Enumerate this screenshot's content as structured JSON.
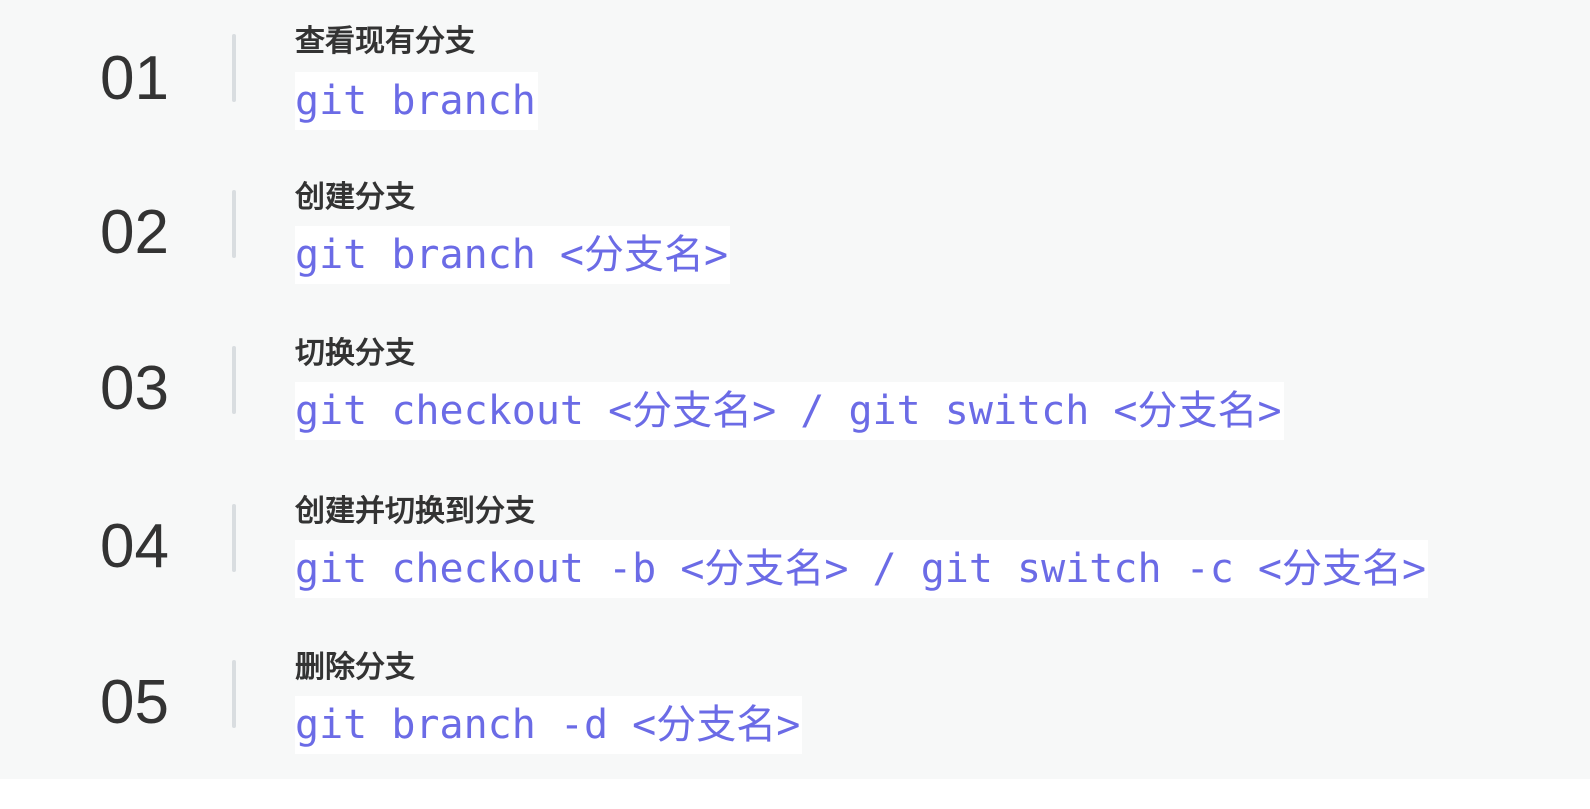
{
  "items": [
    {
      "number": "01",
      "title": "查看现有分支",
      "command": "git branch"
    },
    {
      "number": "02",
      "title": "创建分支",
      "command": "git branch <分支名>"
    },
    {
      "number": "03",
      "title": "切换分支",
      "command": "git checkout <分支名> / git switch <分支名>"
    },
    {
      "number": "04",
      "title": "创建并切换到分支",
      "command": "git checkout -b <分支名> / git switch -c <分支名>"
    },
    {
      "number": "05",
      "title": "删除分支",
      "command": "git branch -d <分支名>"
    }
  ],
  "colors": {
    "background": "#f7f8f8",
    "number": "#333333",
    "title": "#333333",
    "command": "#6b6be6",
    "command_background": "#ffffff",
    "divider": "#d9dde0"
  }
}
